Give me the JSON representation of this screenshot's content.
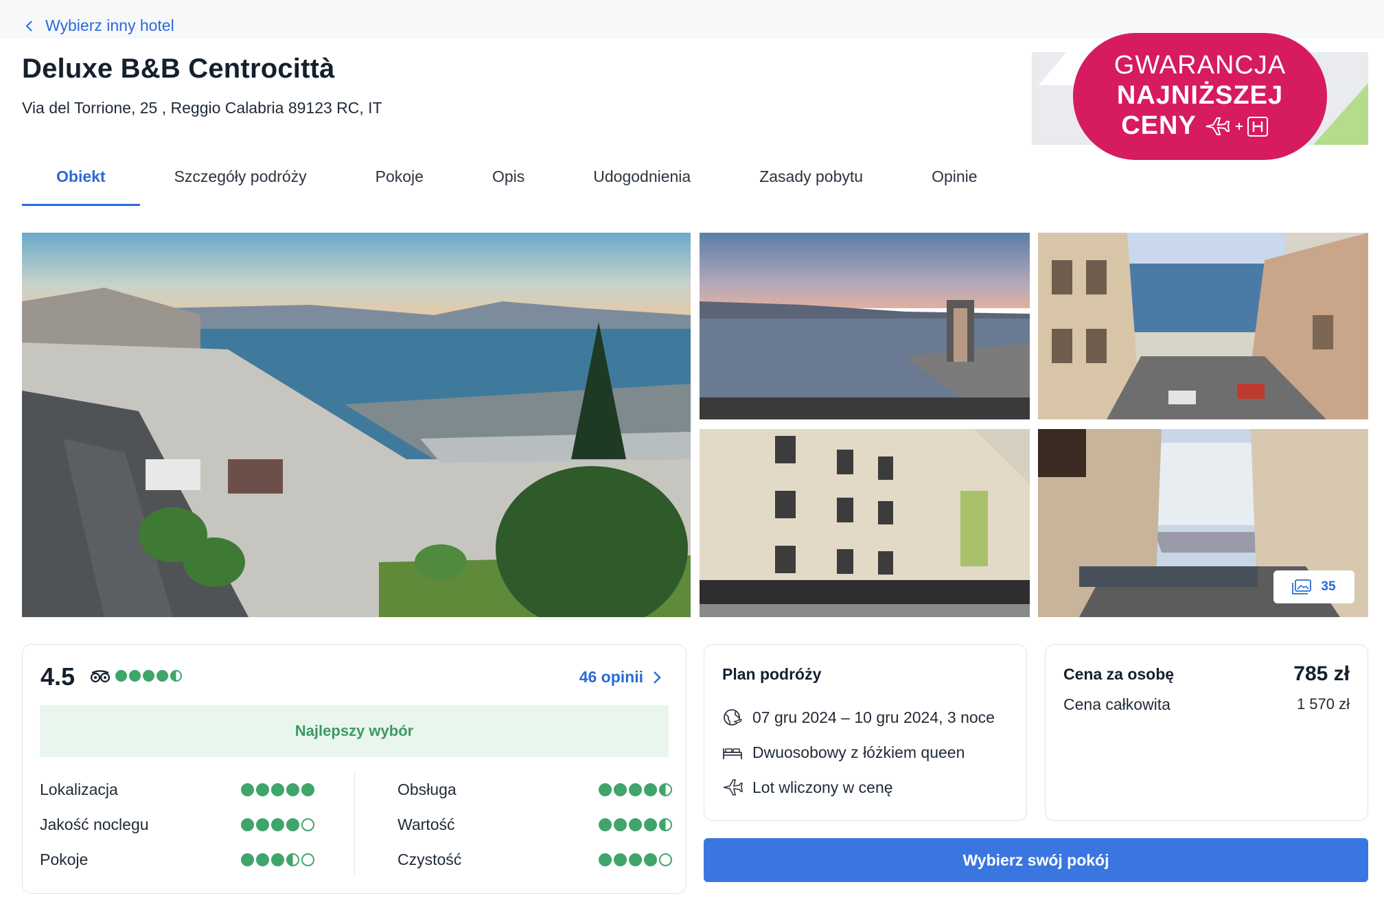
{
  "nav": {
    "back_label": "Wybierz inny hotel"
  },
  "hotel": {
    "name": "Deluxe B&B Centrocittà",
    "address": "Via del Torrione, 25 , Reggio Calabria 89123 RC, IT"
  },
  "guarantee": {
    "line1": "GWARANCJA",
    "line2": "NAJNIŻSZEJ",
    "line3": "CENY"
  },
  "tabs": [
    {
      "label": "Obiekt",
      "active": true
    },
    {
      "label": "Szczegóły podróży"
    },
    {
      "label": "Pokoje"
    },
    {
      "label": "Opis"
    },
    {
      "label": "Udogodnienia"
    },
    {
      "label": "Zasady pobytu"
    },
    {
      "label": "Opinie"
    }
  ],
  "gallery": {
    "photo_count": "35"
  },
  "rating": {
    "score": "4.5",
    "bubbles": 4.5,
    "reviews_link": "46 opinii",
    "badge": "Najlepszy wybór",
    "left": [
      {
        "label": "Lokalizacja",
        "value": 5
      },
      {
        "label": "Jakość noclegu",
        "value": 4
      },
      {
        "label": "Pokoje",
        "value": 3.5
      }
    ],
    "right": [
      {
        "label": "Obsługa",
        "value": 4.5
      },
      {
        "label": "Wartość",
        "value": 4.5
      },
      {
        "label": "Czystość",
        "value": 4
      }
    ]
  },
  "plan": {
    "title": "Plan podróży",
    "dates": "07 gru 2024 – 10 gru 2024, 3 noce",
    "room": "Dwuosobowy z łóżkiem queen",
    "flight": "Lot wliczony w cenę"
  },
  "price": {
    "per_person_label": "Cena za osobę",
    "per_person_value": "785 zł",
    "total_label": "Cena całkowita",
    "total_value": "1 570 zł"
  },
  "cta": {
    "select_room": "Wybierz swój pokój"
  },
  "colors": {
    "accent": "#2a6ad8",
    "brand_pink": "#d61b61",
    "rating_green": "#3fa56b",
    "cta_blue": "#3a76e0"
  }
}
